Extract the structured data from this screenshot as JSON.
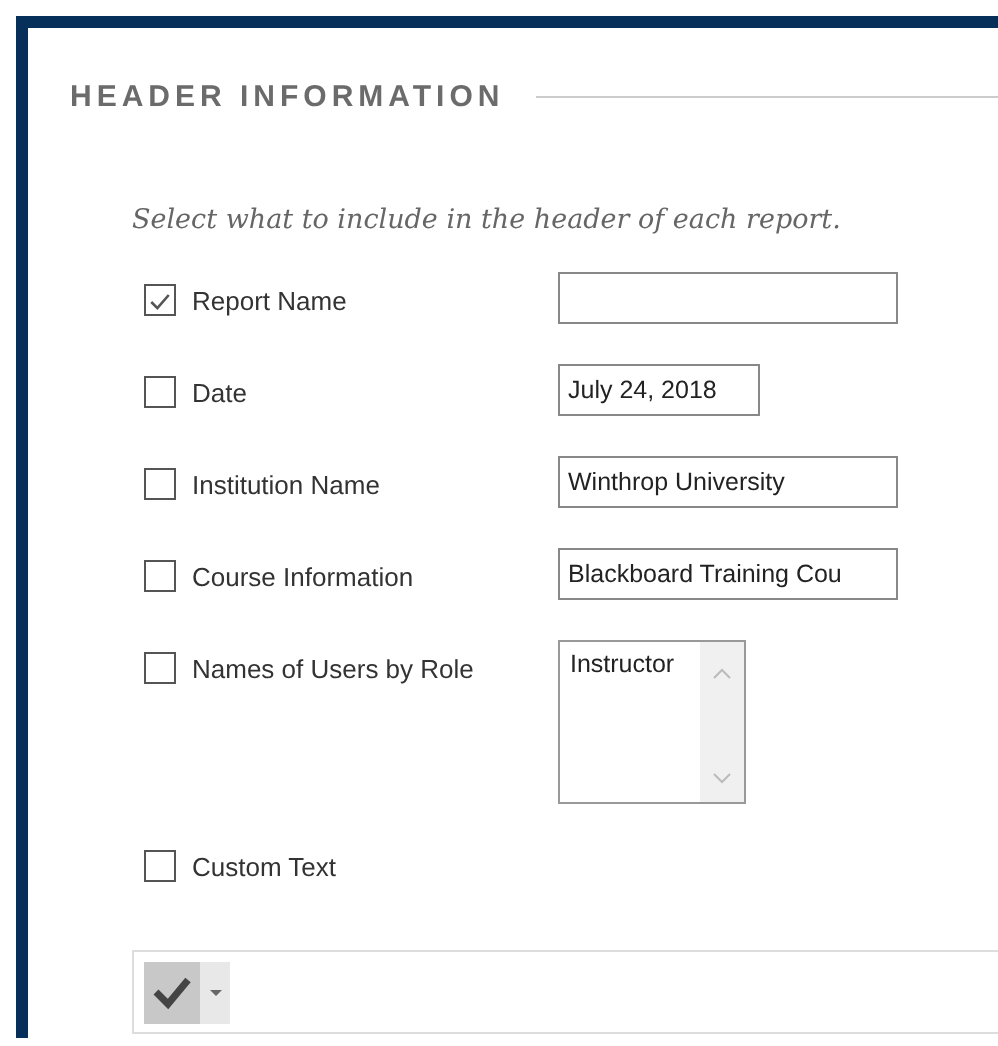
{
  "section": {
    "title": "HEADER INFORMATION",
    "instruction": "Select what to include in the header of each report."
  },
  "options": [
    {
      "label": "Report Name",
      "checked": true,
      "field": {
        "kind": "text"
      }
    },
    {
      "label": "Date",
      "checked": false,
      "field": {
        "kind": "date",
        "value": "July 24, 2018"
      }
    },
    {
      "label": "Institution Name",
      "checked": false,
      "field": {
        "kind": "text",
        "value": "Winthrop University"
      }
    },
    {
      "label": "Course Information",
      "checked": false,
      "field": {
        "kind": "text",
        "value": "Blackboard Training Cou"
      }
    },
    {
      "label": "Names of Users by Role",
      "checked": false,
      "field": {
        "kind": "list",
        "items": [
          "Instructor"
        ]
      }
    },
    {
      "label": "Custom Text",
      "checked": false
    }
  ],
  "editor": {
    "toolbar": [
      {
        "kind": "spellcheck"
      }
    ]
  }
}
